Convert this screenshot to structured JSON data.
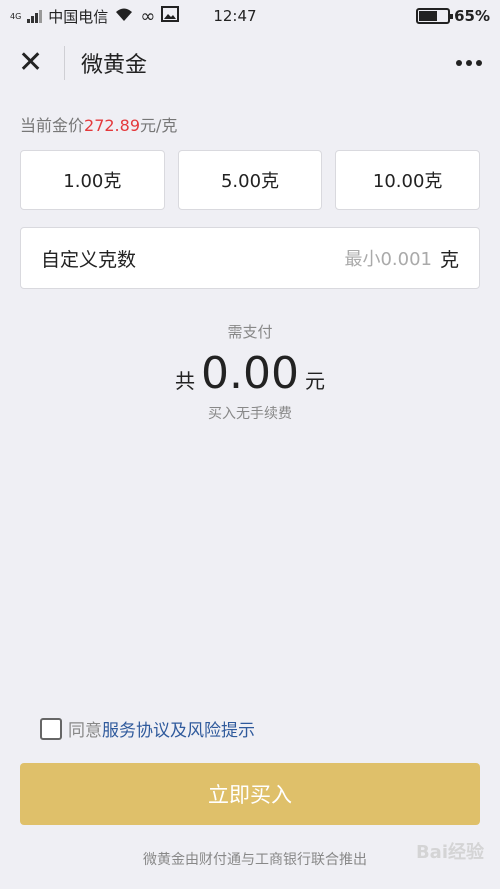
{
  "status_bar": {
    "network": "4G",
    "carrier": "中国电信",
    "time": "12:47",
    "battery": "65%",
    "battery_level": 0.65
  },
  "nav": {
    "close_icon": "close-icon",
    "title": "微黄金",
    "more_icon": "more-icon"
  },
  "price": {
    "prefix": "当前金价",
    "value": "272.89",
    "unit": "元/克",
    "accent_color": "#e4393c"
  },
  "options": [
    "1.00克",
    "5.00克",
    "10.00克"
  ],
  "custom": {
    "label": "自定义克数",
    "placeholder": "最小0.001",
    "unit": "克"
  },
  "payment": {
    "need_label": "需支付",
    "total_prefix": "共",
    "amount": "0.00",
    "currency": "元",
    "fee_note": "买入无手续费"
  },
  "agreement": {
    "prefix": "同意",
    "link_text": "服务协议及风险提示",
    "checked": false
  },
  "buy_button": {
    "label": "立即买入",
    "color": "#dfc06a"
  },
  "footer": "微黄金由财付通与工商银行联合推出",
  "watermark": "Bai经验"
}
